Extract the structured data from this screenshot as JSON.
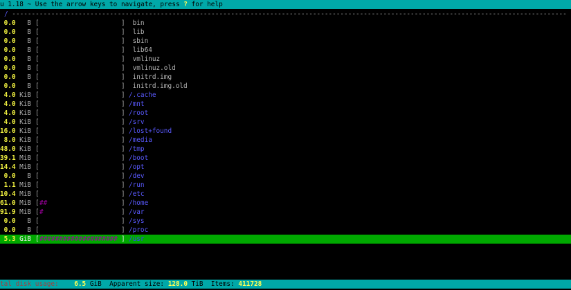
{
  "header": {
    "text_before": "u 1.18 ~ Use the arrow keys to navigate, press ",
    "help_key": "?",
    "text_after": " for help"
  },
  "path": {
    "current": "/",
    "rule": " ----------------------------------------------------------------------------------------------------------------------------------------------"
  },
  "entries": [
    {
      "size": "0.0",
      "unit": "B",
      "bar": "",
      "name": " bin",
      "dir": false
    },
    {
      "size": "0.0",
      "unit": "B",
      "bar": "",
      "name": " lib",
      "dir": false
    },
    {
      "size": "0.0",
      "unit": "B",
      "bar": "",
      "name": " sbin",
      "dir": false
    },
    {
      "size": "0.0",
      "unit": "B",
      "bar": "",
      "name": " lib64",
      "dir": false
    },
    {
      "size": "0.0",
      "unit": "B",
      "bar": "",
      "name": " vmlinuz",
      "dir": false
    },
    {
      "size": "0.0",
      "unit": "B",
      "bar": "",
      "name": " vmlinuz.old",
      "dir": false
    },
    {
      "size": "0.0",
      "unit": "B",
      "bar": "",
      "name": " initrd.img",
      "dir": false
    },
    {
      "size": "0.0",
      "unit": "B",
      "bar": "",
      "name": " initrd.img.old",
      "dir": false
    },
    {
      "size": "4.0",
      "unit": "KiB",
      "bar": "",
      "name": "/.cache",
      "dir": true
    },
    {
      "size": "4.0",
      "unit": "KiB",
      "bar": "",
      "name": "/mnt",
      "dir": true
    },
    {
      "size": "4.0",
      "unit": "KiB",
      "bar": "",
      "name": "/root",
      "dir": true
    },
    {
      "size": "4.0",
      "unit": "KiB",
      "bar": "",
      "name": "/srv",
      "dir": true
    },
    {
      "size": "16.0",
      "unit": "KiB",
      "bar": "",
      "name": "/lost+found",
      "dir": true
    },
    {
      "size": "8.0",
      "unit": "KiB",
      "bar": "",
      "name": "/media",
      "dir": true
    },
    {
      "size": "48.0",
      "unit": "KiB",
      "bar": "",
      "name": "/tmp",
      "dir": true
    },
    {
      "size": "39.1",
      "unit": "MiB",
      "bar": "",
      "name": "/boot",
      "dir": true
    },
    {
      "size": "14.4",
      "unit": "MiB",
      "bar": "",
      "name": "/opt",
      "dir": true
    },
    {
      "size": "0.0",
      "unit": "B",
      "bar": "",
      "name": "/dev",
      "dir": true
    },
    {
      "size": "1.1",
      "unit": "MiB",
      "bar": "",
      "name": "/run",
      "dir": true
    },
    {
      "size": "10.4",
      "unit": "MiB",
      "bar": "",
      "name": "/etc",
      "dir": true
    },
    {
      "size": "61.0",
      "unit": "MiB",
      "bar": "##",
      "name": "/home",
      "dir": true
    },
    {
      "size": "91.9",
      "unit": "MiB",
      "bar": "#",
      "name": "/var",
      "dir": true
    },
    {
      "size": "0.0",
      "unit": "B",
      "bar": "",
      "name": "/sys",
      "dir": true
    },
    {
      "size": "0.0",
      "unit": "B",
      "bar": "",
      "name": "/proc",
      "dir": true
    },
    {
      "size": "5.3",
      "unit": "GiB",
      "bar": "####################",
      "name": "/usr",
      "dir": true,
      "selected": true
    }
  ],
  "footer": {
    "disk_label": "tal disk usage:",
    "disk_value": "6.5",
    "disk_unit": " GiB",
    "apparent_label": "Apparent size:",
    "apparent_value": "128.0",
    "apparent_unit": " TiB",
    "items_label": "Items:",
    "items_value": "411728"
  },
  "colors": {
    "bar_bg": "#00a8a8",
    "selected_bg": "#00a800",
    "size": "#f0f040",
    "dir": "#5a5aff",
    "graph": "#a000a0"
  }
}
